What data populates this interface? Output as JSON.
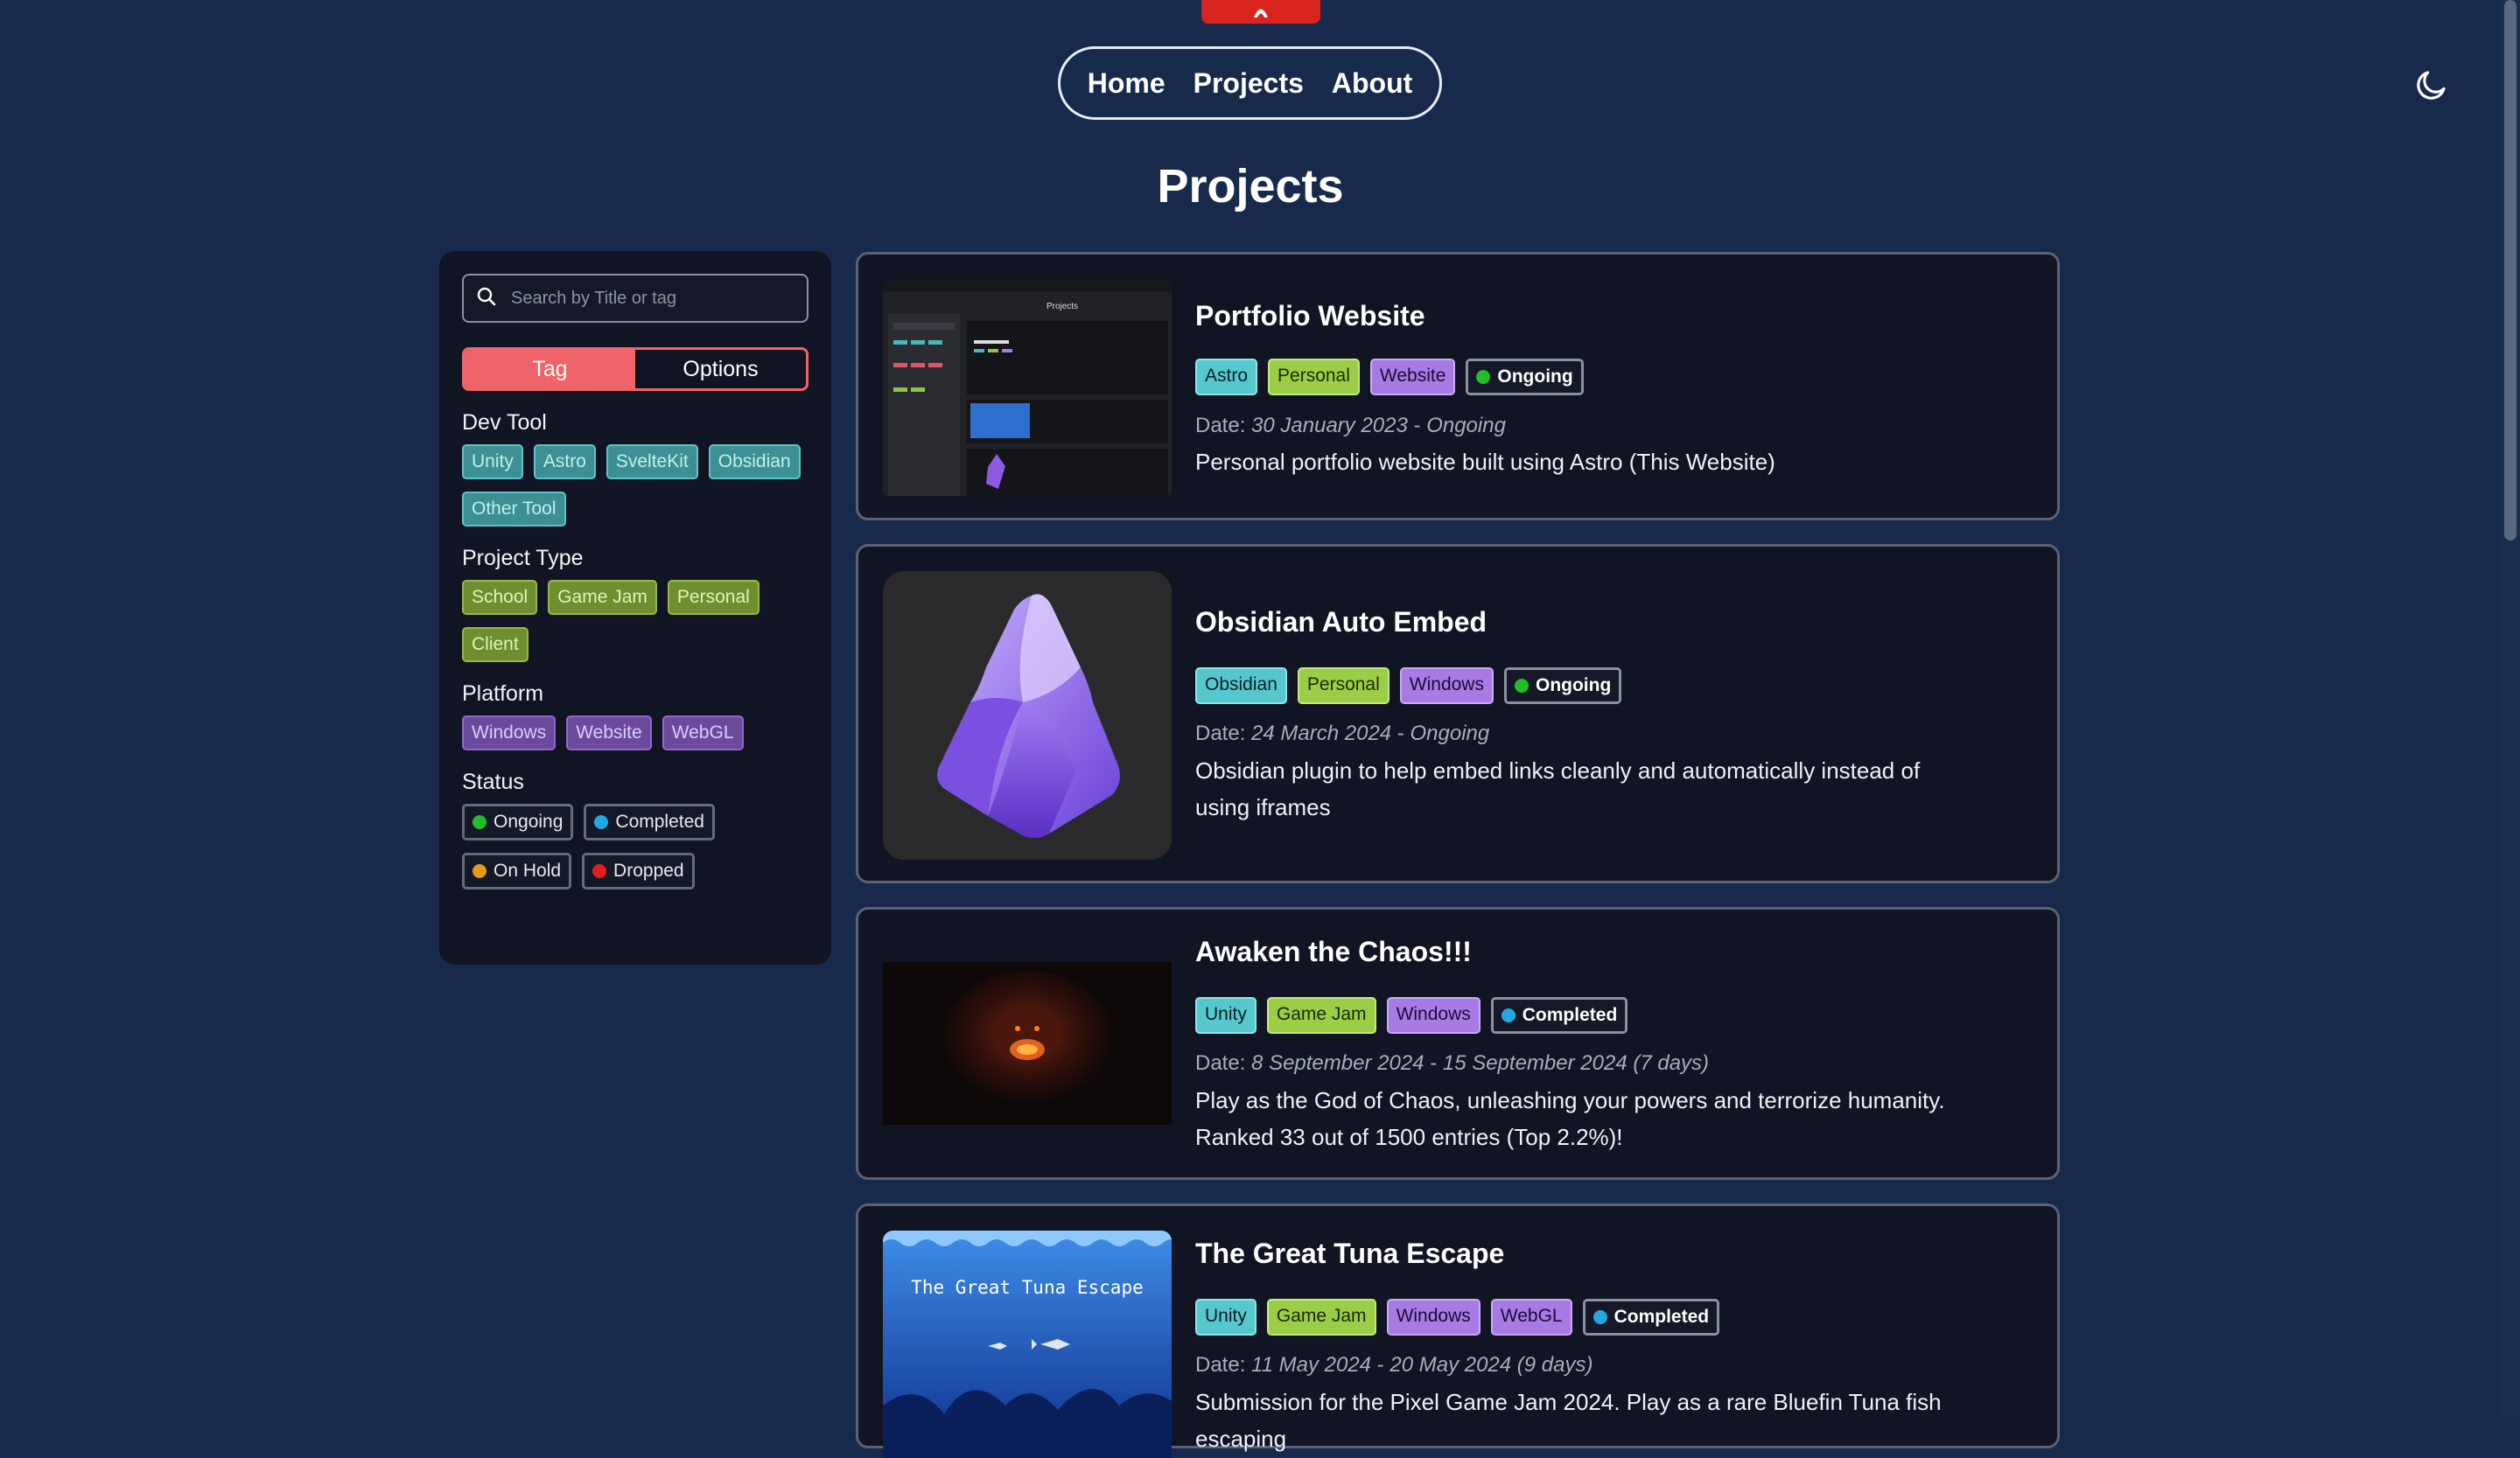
{
  "nav": {
    "home": "Home",
    "projects": "Projects",
    "about": "About"
  },
  "page": {
    "title": "Projects"
  },
  "sidebar": {
    "search_placeholder": "Search by Title or tag",
    "seg_tag": "Tag",
    "seg_options": "Options",
    "dev_tool_title": "Dev Tool",
    "dev_tools": [
      "Unity",
      "Astro",
      "SvelteKit",
      "Obsidian",
      "Other Tool"
    ],
    "project_type_title": "Project Type",
    "project_types": [
      "School",
      "Game Jam",
      "Personal",
      "Client"
    ],
    "platform_title": "Platform",
    "platforms": [
      "Windows",
      "Website",
      "WebGL"
    ],
    "status_title": "Status",
    "statuses": [
      {
        "label": "Ongoing",
        "color": "#1fbf2b"
      },
      {
        "label": "Completed",
        "color": "#22a8e0"
      },
      {
        "label": "On Hold",
        "color": "#e89a12"
      },
      {
        "label": "Dropped",
        "color": "#e01e1e"
      }
    ]
  },
  "projects": [
    {
      "title": "Portfolio Website",
      "tags": [
        "Astro",
        "Personal",
        "Website"
      ],
      "status": "Ongoing",
      "date_label": "Date:",
      "date": "30 January 2023",
      "date_end": "Ongoing",
      "description": "Personal portfolio website built using Astro (This Website)",
      "thumb_text": "Projects"
    },
    {
      "title": "Obsidian Auto Embed",
      "tags": [
        "Obsidian",
        "Personal",
        "Windows"
      ],
      "status": "Ongoing",
      "date_label": "Date:",
      "date": "24 March 2024",
      "date_end": "Ongoing",
      "description": "Obsidian plugin to help embed links cleanly and automatically instead of using iframes"
    },
    {
      "title": "Awaken the Chaos!!!",
      "tags": [
        "Unity",
        "Game Jam",
        "Windows"
      ],
      "status": "Completed",
      "date_label": "Date:",
      "date": "8 September 2024",
      "date_end": "15 September 2024 (7 days)",
      "description": "Play as the God of Chaos, unleashing your powers and terrorize humanity. Ranked 33 out of 1500 entries (Top 2.2%)!"
    },
    {
      "title": "The Great Tuna Escape",
      "tags": [
        "Unity",
        "Game Jam",
        "Windows",
        "WebGL"
      ],
      "status": "Completed",
      "date_label": "Date:",
      "date": "11 May 2024",
      "date_end": "20 May 2024 (9 days)",
      "description": "Submission for the Pixel Game Jam 2024. Play as a rare Bluefin Tuna fish escaping",
      "thumb_text": "The Great Tuna Escape"
    }
  ],
  "colors": {
    "background": "#172a4c",
    "panel": "#111423",
    "accent": "#ef6469",
    "ongoing": "#1fbf2b",
    "completed": "#22a8e0"
  }
}
